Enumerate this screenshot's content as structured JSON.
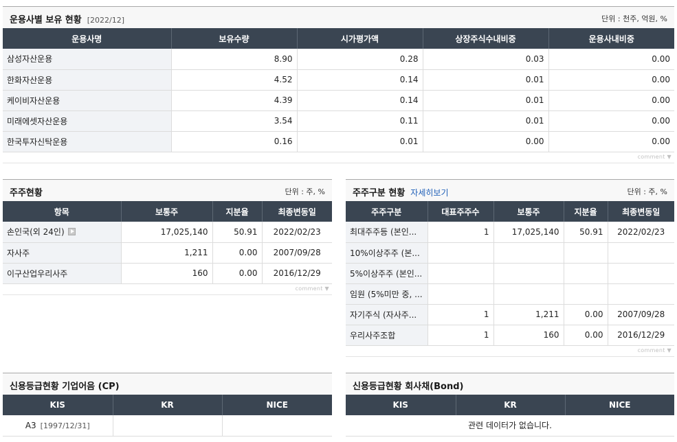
{
  "top": {
    "title": "운용사별 보유 현황",
    "date": "[2022/12]",
    "unit": "단위 : 천주, 억원, %",
    "headers": [
      "운용사명",
      "보유수량",
      "시가평가액",
      "상장주식수내비중",
      "운용사내비중"
    ],
    "rows": [
      [
        "삼성자산운용",
        "8.90",
        "0.28",
        "0.03",
        "0.00"
      ],
      [
        "한화자산운용",
        "4.52",
        "0.14",
        "0.01",
        "0.00"
      ],
      [
        "케이비자산운용",
        "4.39",
        "0.14",
        "0.01",
        "0.00"
      ],
      [
        "미래에셋자산운용",
        "3.54",
        "0.11",
        "0.01",
        "0.00"
      ],
      [
        "한국투자신탁운용",
        "0.16",
        "0.01",
        "0.00",
        "0.00"
      ]
    ],
    "comment": "comment ▼"
  },
  "shareholders": {
    "title": "주주현황",
    "unit": "단위 : 주, %",
    "headers": [
      "항목",
      "보통주",
      "지분율",
      "최종변동일"
    ],
    "rows": [
      [
        "손인국(외 24인)",
        "17,025,140",
        "50.91",
        "2022/02/23"
      ],
      [
        "자사주",
        "1,211",
        "0.00",
        "2007/09/28"
      ],
      [
        "이구산업우리사주",
        "160",
        "0.00",
        "2016/12/29"
      ]
    ],
    "comment": "comment ▼"
  },
  "share_dist": {
    "title": "주주구분 현황",
    "link": "자세히보기",
    "unit": "단위 : 주, %",
    "headers": [
      "주주구분",
      "대표주주수",
      "보통주",
      "지분율",
      "최종변동일"
    ],
    "rows": [
      [
        "최대주주등 (본인...",
        "1",
        "17,025,140",
        "50.91",
        "2022/02/23"
      ],
      [
        "10%이상주주 (본...",
        "",
        "",
        "",
        ""
      ],
      [
        "5%이상주주 (본인...",
        "",
        "",
        "",
        ""
      ],
      [
        "임원 (5%미만 중, ...",
        "",
        "",
        "",
        ""
      ],
      [
        "자기주식 (자사주...",
        "1",
        "1,211",
        "0.00",
        "2007/09/28"
      ],
      [
        "우리사주조합",
        "1",
        "160",
        "0.00",
        "2016/12/29"
      ]
    ],
    "comment": "comment ▼"
  },
  "credit_cp": {
    "title": "신용등급현황 기업어음 (CP)",
    "headers": [
      "KIS",
      "KR",
      "NICE"
    ],
    "kis_grade": "A3",
    "kis_date": "[1997/12/31]"
  },
  "credit_bond": {
    "title": "신용등급현황 회사채(Bond)",
    "headers": [
      "KIS",
      "KR",
      "NICE"
    ],
    "empty": "관련 데이터가 없습니다."
  }
}
